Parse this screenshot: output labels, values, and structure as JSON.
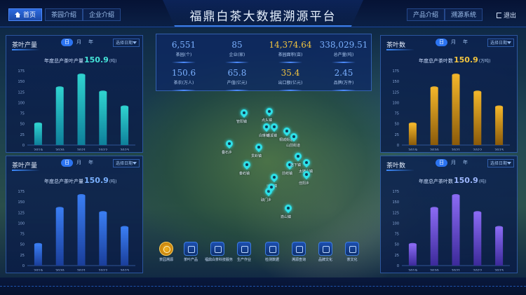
{
  "app": {
    "title": "福鼎白茶大数据溯源平台"
  },
  "nav_left": [
    {
      "label": "首页",
      "active": true
    },
    {
      "label": "茶园介绍",
      "active": false
    },
    {
      "label": "企业介绍",
      "active": false
    }
  ],
  "nav_right": [
    {
      "label": "产品介绍",
      "active": false
    },
    {
      "label": "溯源系统",
      "active": false
    }
  ],
  "exit": {
    "label": "退出"
  },
  "kpis": [
    {
      "value": "6,551",
      "label": "茶园(个)"
    },
    {
      "value": "85",
      "label": "企业(家)"
    },
    {
      "value": "14,374.64",
      "label": "茶园面积(亩)",
      "highlight": true
    },
    {
      "value": "338,029.51",
      "label": "总产量(吨)"
    },
    {
      "value": "150.6",
      "label": "茶农(万人)"
    },
    {
      "value": "65.8",
      "label": "产值(亿元)"
    },
    {
      "value": "35.4",
      "label": "出口额(亿元)",
      "highlight": true
    },
    {
      "value": "2.45",
      "label": "品牌(万件)"
    }
  ],
  "panels": [
    {
      "id": "left-top",
      "title": "茶叶产量",
      "tabs": [
        "日",
        "月",
        "年"
      ],
      "active_tab": 0,
      "select": "选择日期",
      "stat_label": "年度总产茶叶产量",
      "stat_value": "150.9",
      "stat_unit": "(吨)",
      "color": "#2fd2cf",
      "color_dark": "#0e7f9a",
      "stat_color": "#45e4d8"
    },
    {
      "id": "left-bottom",
      "title": "茶叶产量",
      "tabs": [
        "日",
        "月",
        "年"
      ],
      "active_tab": 0,
      "select": "选择日期",
      "stat_label": "年度总产茶叶产量",
      "stat_value": "150.9",
      "stat_unit": "(吨)",
      "color": "#3a7df2",
      "color_dark": "#1a3e9a",
      "stat_color": "#7ab0ff"
    },
    {
      "id": "right-top",
      "title": "茶叶数",
      "tabs": [
        "日",
        "月",
        "年"
      ],
      "active_tab": 0,
      "select": "选择日期",
      "stat_label": "年度总产茶叶数",
      "stat_value": "150.9",
      "stat_unit": "(万吨)",
      "color": "#f2b52a",
      "color_dark": "#8a5a0a",
      "stat_color": "#f2c440"
    },
    {
      "id": "right-bottom",
      "title": "茶叶数",
      "tabs": [
        "日",
        "月",
        "年"
      ],
      "active_tab": 0,
      "select": "选择日期",
      "stat_label": "年度总产茶叶数",
      "stat_value": "150.9",
      "stat_unit": "(吨)",
      "color": "#8a6af2",
      "color_dark": "#3c2a9a",
      "stat_color": "#9fb8ff"
    }
  ],
  "chart_data": [
    {
      "type": "bar",
      "categories": [
        "2019",
        "2020",
        "2021",
        "2022",
        "2023"
      ],
      "values": [
        50,
        135,
        165,
        125,
        90
      ],
      "ylim": [
        0,
        175
      ],
      "yticks": [
        0,
        25,
        50,
        75,
        100,
        125,
        150,
        175
      ]
    },
    {
      "type": "bar",
      "categories": [
        "2019",
        "2020",
        "2021",
        "2022",
        "2023"
      ],
      "values": [
        50,
        135,
        165,
        125,
        90
      ],
      "ylim": [
        0,
        175
      ],
      "yticks": [
        0,
        25,
        50,
        75,
        100,
        125,
        150,
        175
      ]
    },
    {
      "type": "bar",
      "categories": [
        "2019",
        "2020",
        "2021",
        "2022",
        "2023"
      ],
      "values": [
        50,
        135,
        165,
        125,
        90
      ],
      "ylim": [
        0,
        175
      ],
      "yticks": [
        0,
        25,
        50,
        75,
        100,
        125,
        150,
        175
      ]
    },
    {
      "type": "bar",
      "categories": [
        "2019",
        "2020",
        "2021",
        "2022",
        "2023"
      ],
      "values": [
        50,
        135,
        165,
        125,
        90
      ],
      "ylim": [
        0,
        175
      ],
      "yticks": [
        0,
        25,
        50,
        75,
        100,
        125,
        150,
        175
      ]
    }
  ],
  "map_pins": [
    {
      "label": "管阳镇"
    },
    {
      "label": "点头镇"
    },
    {
      "label": "白琳镇"
    },
    {
      "label": "磻溪镇"
    },
    {
      "label": "桐城街道"
    },
    {
      "label": "山前街道"
    },
    {
      "label": "贯岭镇"
    },
    {
      "label": "叠石乡"
    },
    {
      "label": "前岐镇"
    },
    {
      "label": "店下镇"
    },
    {
      "label": "太姥山镇"
    },
    {
      "label": "秦屿镇"
    },
    {
      "label": "沙埕镇"
    },
    {
      "label": "硖门乡"
    },
    {
      "label": "嵛山镇"
    },
    {
      "label": "佳阳乡"
    },
    {
      "label": ""
    }
  ],
  "tools": [
    {
      "label": "茶园溯源",
      "active": true
    },
    {
      "label": "茶叶产品",
      "active": false
    },
    {
      "label": "福鼎白茶科技服务",
      "active": false
    },
    {
      "label": "生产作业",
      "active": false
    },
    {
      "label": "检测数据",
      "active": false
    },
    {
      "label": "溯源查询",
      "active": false
    },
    {
      "label": "品牌文化",
      "active": false
    },
    {
      "label": "茶文化",
      "active": false
    }
  ]
}
